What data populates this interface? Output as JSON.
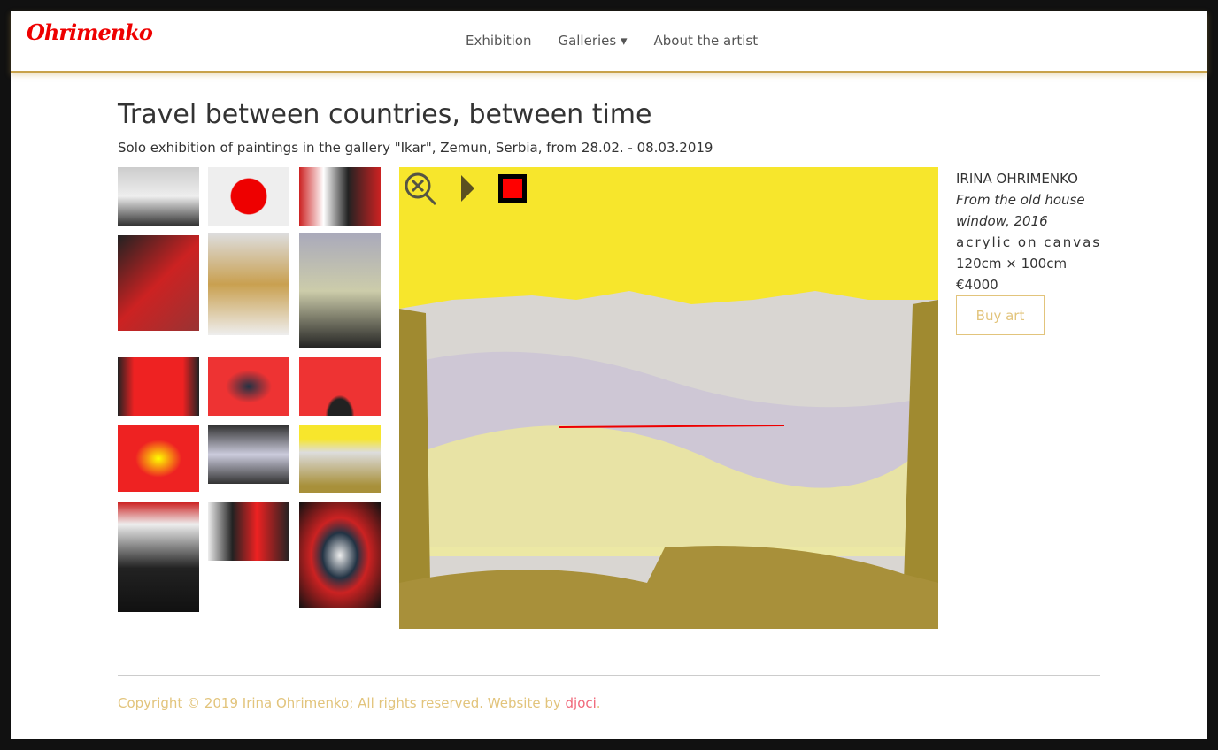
{
  "brand": {
    "logo_text": "Ohrimenko",
    "color": "#e00000"
  },
  "nav": {
    "items": [
      {
        "label": "Exhibition"
      },
      {
        "label": "Galleries ▾"
      },
      {
        "label": "About the artist"
      }
    ]
  },
  "page": {
    "title": "Travel between countries, between time",
    "subtitle": "Solo exhibition of paintings in the gallery \"Ikar\", Zemun, Serbia, from 28.02. - 08.03.2019"
  },
  "viewer": {
    "controls": [
      "zoom-fit-icon",
      "play-icon",
      "stop-icon"
    ]
  },
  "artwork": {
    "artist": "IRINA OHRIMENKO",
    "title": "From the old house window, 2016",
    "medium": "acrylic on canvas",
    "size": "120cm × 100cm",
    "price": "€4000",
    "buy_label": "Buy art"
  },
  "footer": {
    "text": "Copyright © 2019 Irina Ohrimenko; All rights reserved. Website by ",
    "link": "djoci",
    "end": "."
  }
}
